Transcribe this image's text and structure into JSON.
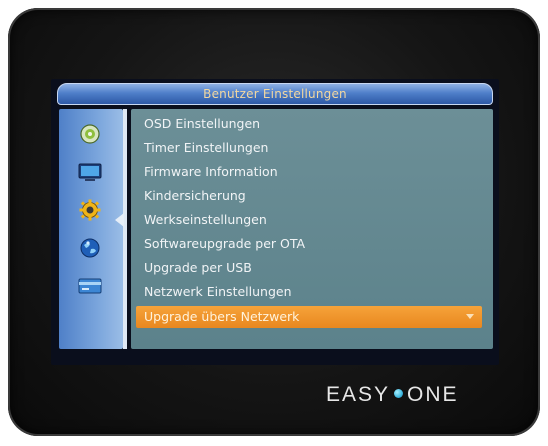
{
  "window": {
    "title": "Benutzer Einstellungen"
  },
  "sidebar": {
    "icons": [
      {
        "name": "disc-icon"
      },
      {
        "name": "tv-screen-icon"
      },
      {
        "name": "gear-icon"
      },
      {
        "name": "globe-icon"
      },
      {
        "name": "card-icon"
      }
    ]
  },
  "menu": {
    "items": [
      {
        "label": "OSD Einstellungen",
        "selected": false
      },
      {
        "label": "Timer Einstellungen",
        "selected": false
      },
      {
        "label": "Firmware Information",
        "selected": false
      },
      {
        "label": "Kindersicherung",
        "selected": false
      },
      {
        "label": "Werkseinstellungen",
        "selected": false
      },
      {
        "label": "Softwareupgrade per OTA",
        "selected": false
      },
      {
        "label": "Upgrade per USB",
        "selected": false
      },
      {
        "label": "Netzwerk Einstellungen",
        "selected": false
      },
      {
        "label": "Upgrade übers Netzwerk",
        "selected": true
      }
    ]
  },
  "device": {
    "brand_left": "EASY",
    "brand_right": "ONE"
  },
  "colors": {
    "accent": "#e8871f",
    "titlebar": "#2d58a6",
    "menu_background": "#5c828b"
  }
}
